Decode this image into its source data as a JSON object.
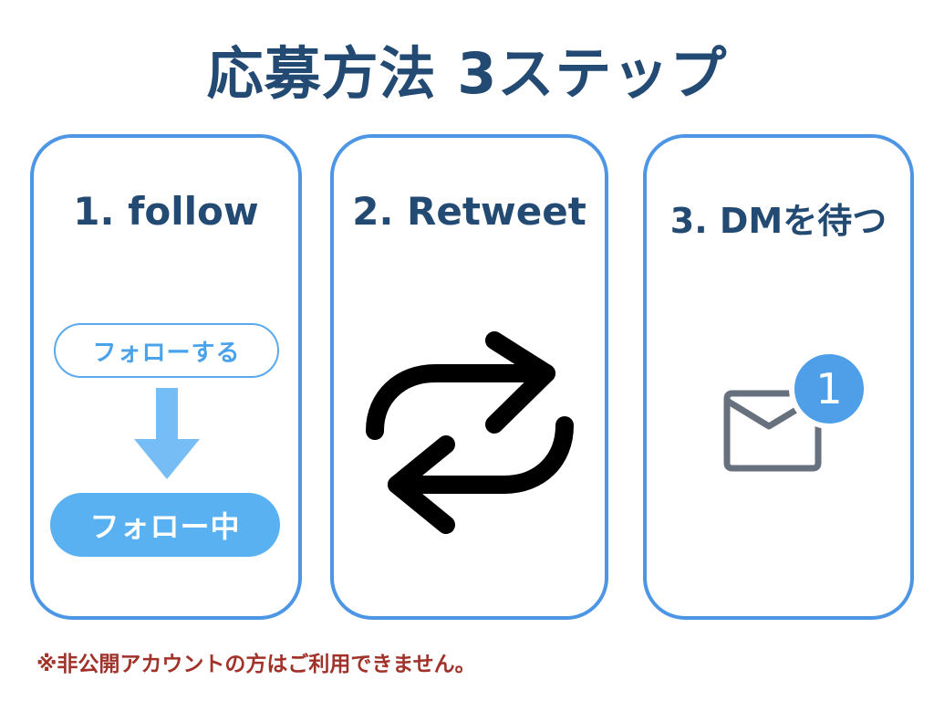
{
  "title": "応募方法 3ステップ",
  "steps": [
    {
      "label": "1. follow",
      "follow_button_label": "フォローする",
      "following_button_label": "フォロー中",
      "arrow_icon": "arrow-down-icon"
    },
    {
      "label": "2. Retweet",
      "icon": "retweet-icon"
    },
    {
      "label": "3. DMを待つ",
      "icon": "mail-icon",
      "badge_count": "1"
    }
  ],
  "note": "※非公開アカウントの方はご利用できません。",
  "colors": {
    "title": "#234a73",
    "card_border": "#4d96e6",
    "follow_blue": "#5ab1f2",
    "arrow_blue": "#76bdf6",
    "badge_blue": "#4e9ee8",
    "mail_gray": "#67717d",
    "note_red": "#a0322a"
  }
}
